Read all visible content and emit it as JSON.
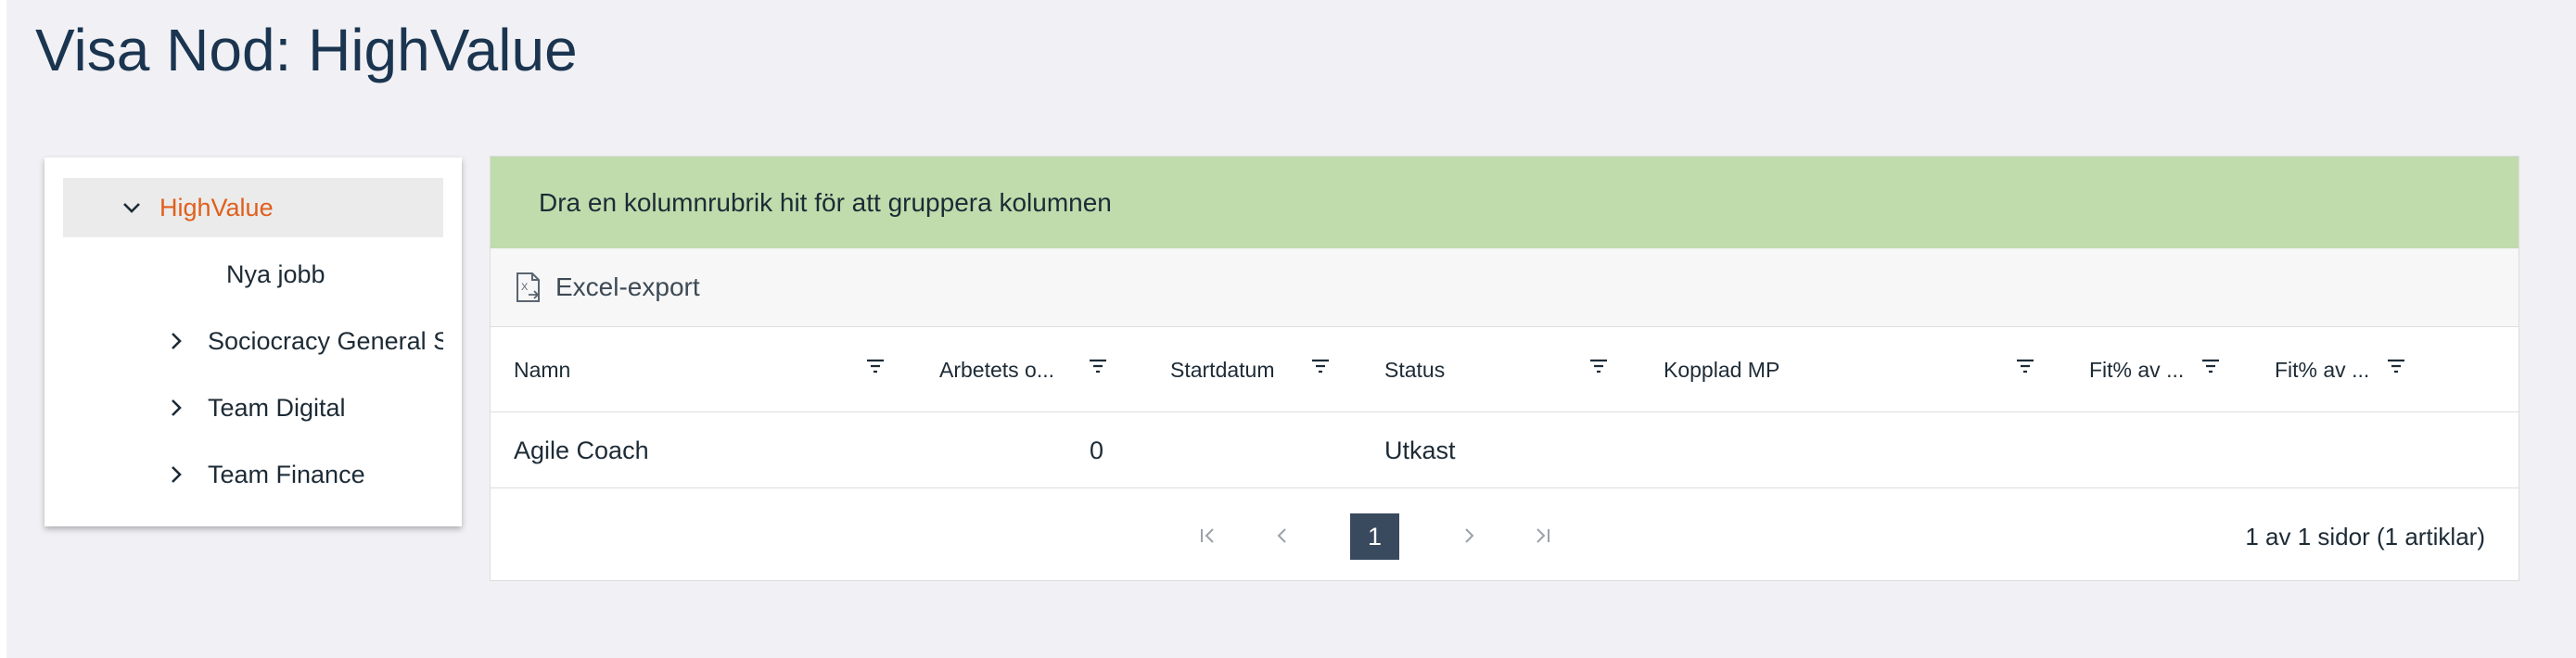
{
  "page": {
    "title": "Visa Nod: HighValue"
  },
  "tree": {
    "items": [
      {
        "label": "HighValue",
        "expandable": true,
        "expanded": true,
        "selected": true
      },
      {
        "label": "Nya jobb",
        "expandable": false
      },
      {
        "label": "Sociocracy General S",
        "expandable": true,
        "expanded": false
      },
      {
        "label": "Team Digital",
        "expandable": true,
        "expanded": false
      },
      {
        "label": "Team Finance",
        "expandable": true,
        "expanded": false
      }
    ]
  },
  "grid": {
    "group_hint": "Dra en kolumnrubrik hit för att gruppera kolumnen",
    "toolbar": {
      "excel_label": "Excel-export"
    },
    "columns": [
      "Namn",
      "Arbetets o...",
      "Startdatum",
      "Status",
      "Kopplad MP",
      "Fit% av ...",
      "Fit% av ..."
    ],
    "rows": [
      {
        "namn": "Agile Coach",
        "arbetets": "0",
        "startdatum": "",
        "status": "Utkast",
        "kopplad_mp": "",
        "fit1": "",
        "fit2": ""
      }
    ],
    "pager": {
      "current_page": "1",
      "info": "1 av 1 sidor (1 artiklar)"
    }
  },
  "colors": {
    "accent": "#e05f1c",
    "group_bar": "#c0dcac",
    "pager_active": "#3a4a5e",
    "title": "#1b3550"
  }
}
